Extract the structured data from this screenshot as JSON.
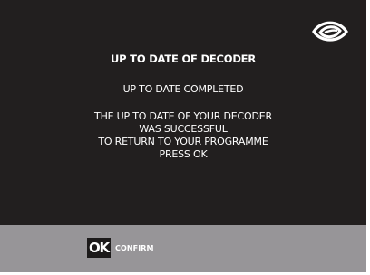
{
  "dialog": {
    "title": "UP TO DATE OF DECODER",
    "status": "UP TO DATE COMPLETED",
    "message_lines": [
      "THE UP TO DATE OF YOUR DECODER",
      "WAS SUCCESSFUL",
      "TO RETURN TO YOUR PROGRAMME",
      "PRESS OK"
    ]
  },
  "footer": {
    "ok_key": "OK",
    "confirm_label": "CONFIRM"
  },
  "logo": {
    "icon": "eye-logo-icon"
  },
  "colors": {
    "background": "#221f1f",
    "footer": "#979598",
    "text": "#ffffff"
  }
}
